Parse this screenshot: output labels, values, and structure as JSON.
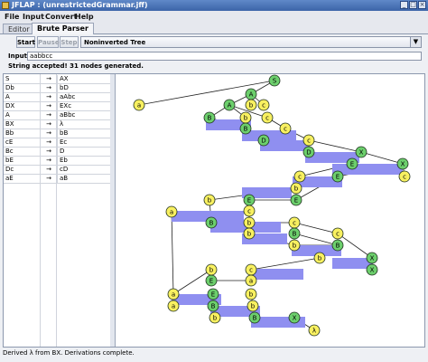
{
  "window": {
    "title": "JFLAP : (unrestrictedGrammar.jff)"
  },
  "menu": [
    "File",
    "Input",
    "Convert",
    "Help"
  ],
  "tabs": [
    {
      "label": "Editor"
    },
    {
      "label": "Brute Parser"
    }
  ],
  "toolbar": {
    "start_label": "Start",
    "pause_label": "Pause",
    "step_label": "Step",
    "view_selected": "Noninverted Tree"
  },
  "input": {
    "label": "Input",
    "value": "aabbcc"
  },
  "status": "String accepted!  31 nodes generated.",
  "grammar": {
    "arrow": "→",
    "productions": [
      {
        "lhs": "S",
        "rhs": "AX"
      },
      {
        "lhs": "Db",
        "rhs": "bD"
      },
      {
        "lhs": "A",
        "rhs": "aAbc"
      },
      {
        "lhs": "DX",
        "rhs": "EXc"
      },
      {
        "lhs": "A",
        "rhs": "aBbc"
      },
      {
        "lhs": "BX",
        "rhs": "λ"
      },
      {
        "lhs": "Bb",
        "rhs": "bB"
      },
      {
        "lhs": "cE",
        "rhs": "Ec"
      },
      {
        "lhs": "Bc",
        "rhs": "D"
      },
      {
        "lhs": "bE",
        "rhs": "Eb"
      },
      {
        "lhs": "Dc",
        "rhs": "cD"
      },
      {
        "lhs": "aE",
        "rhs": "aB"
      }
    ]
  },
  "colors": {
    "variable_node": "#6ccf6c",
    "terminal_node": "#f8f060",
    "highlight_bar": "#8f8ff0"
  },
  "tree_labels": {
    "root": "S",
    "row1": [
      "a",
      "A"
    ],
    "row2": [
      "A",
      "b",
      "c"
    ],
    "row3": [
      "B",
      "b",
      "c"
    ],
    "row4": [
      "B",
      "c"
    ],
    "row5": [
      "D",
      "c"
    ],
    "row6": [
      "D",
      "X"
    ],
    "row7": [
      "E",
      "X",
      "c"
    ],
    "row8": [
      "c",
      "E"
    ],
    "row9": [
      "b",
      "E"
    ],
    "row10": [
      "a",
      "b",
      "E",
      "c"
    ],
    "row11": [
      "B",
      "b",
      "c"
    ],
    "row12": [
      "b",
      "B",
      "c"
    ],
    "row13": [
      "b",
      "B",
      "X"
    ],
    "row14": [
      "b",
      "X",
      "c"
    ],
    "row15": [
      "a",
      "E",
      "b"
    ],
    "row16": [
      "a",
      "E",
      "b"
    ],
    "row17": [
      "a",
      "B",
      "b"
    ],
    "row18": [
      "b",
      "B",
      "X"
    ],
    "row19": [
      "λ"
    ]
  },
  "bottom_status": "Derived λ from BX.  Derivations complete."
}
